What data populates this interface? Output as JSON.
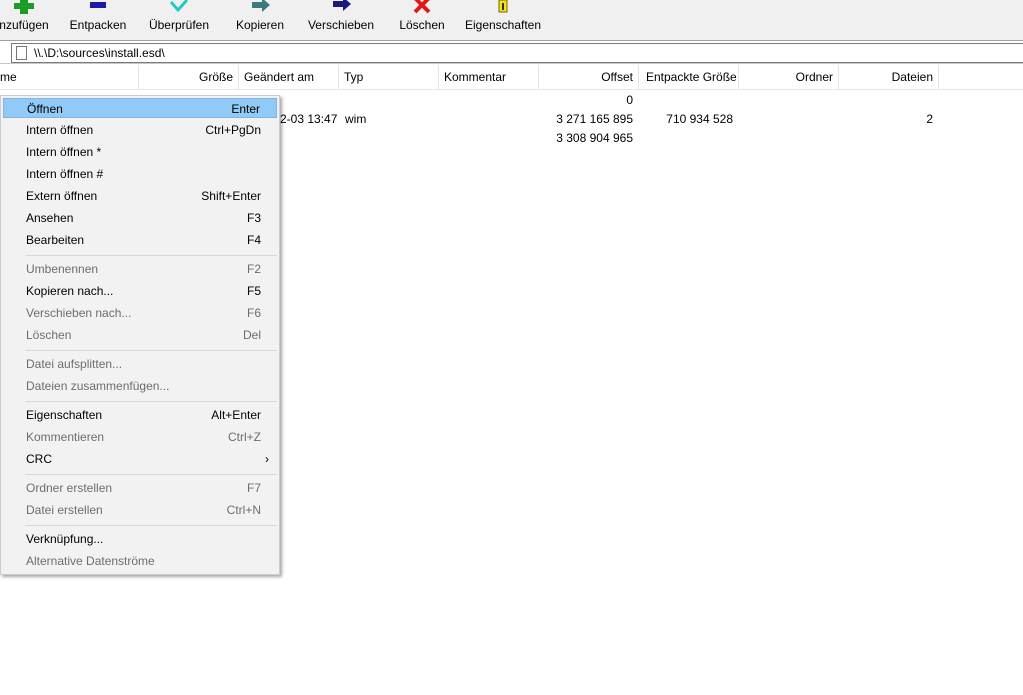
{
  "toolbar": {
    "items": [
      {
        "label": "nzufügen",
        "icon": "add-icon"
      },
      {
        "label": "Entpacken",
        "icon": "extract-icon"
      },
      {
        "label": "Überprüfen",
        "icon": "test-icon"
      },
      {
        "label": "Kopieren",
        "icon": "copy-icon"
      },
      {
        "label": "Verschieben",
        "icon": "move-icon"
      },
      {
        "label": "Löschen",
        "icon": "delete-icon"
      },
      {
        "label": "Eigenschaften",
        "icon": "info-icon"
      }
    ]
  },
  "address": {
    "path": "\\\\.\\D:\\sources\\install.esd\\"
  },
  "columns": [
    "me",
    "Größe",
    "Geändert am",
    "Typ",
    "Kommentar",
    "Offset",
    "Entpackte Größe",
    "Ordner",
    "Dateien"
  ],
  "rows": [
    {
      "offset": "0"
    },
    {
      "modified": "2-03 13:47",
      "type": "wim",
      "offset": "3 271 165 895",
      "unpacked": "710 934 528",
      "files": "2"
    },
    {
      "offset": "3 308 904 965"
    }
  ],
  "menu": {
    "items": [
      {
        "label": "Öffnen",
        "shortcut": "Enter",
        "state": "highlighted"
      },
      {
        "label": "Intern öffnen",
        "shortcut": "Ctrl+PgDn"
      },
      {
        "label": "Intern öffnen *",
        "shortcut": ""
      },
      {
        "label": "Intern öffnen #",
        "shortcut": ""
      },
      {
        "label": "Extern öffnen",
        "shortcut": "Shift+Enter"
      },
      {
        "label": "Ansehen",
        "shortcut": "F3"
      },
      {
        "label": "Bearbeiten",
        "shortcut": "F4"
      },
      {
        "label": "Umbenennen",
        "shortcut": "F2",
        "state": "disabled"
      },
      {
        "label": "Kopieren nach...",
        "shortcut": "F5"
      },
      {
        "label": "Verschieben nach...",
        "shortcut": "F6",
        "state": "disabled"
      },
      {
        "label": "Löschen",
        "shortcut": "Del",
        "state": "disabled"
      },
      {
        "label": "Datei aufsplitten...",
        "shortcut": "",
        "state": "disabled"
      },
      {
        "label": "Dateien zusammenfügen...",
        "shortcut": "",
        "state": "disabled"
      },
      {
        "label": "Eigenschaften",
        "shortcut": "Alt+Enter"
      },
      {
        "label": "Kommentieren",
        "shortcut": "Ctrl+Z",
        "state": "disabled"
      },
      {
        "label": "CRC",
        "shortcut": "›"
      },
      {
        "label": "Ordner erstellen",
        "shortcut": "F7",
        "state": "disabled"
      },
      {
        "label": "Datei erstellen",
        "shortcut": "Ctrl+N",
        "state": "disabled"
      },
      {
        "label": "Verknüpfung...",
        "shortcut": ""
      },
      {
        "label": "Alternative Datenströme",
        "shortcut": "",
        "state": "disabled"
      }
    ]
  },
  "colors": {
    "highlight": "#91c9f7",
    "disabled_text": "#6d6d6d"
  }
}
